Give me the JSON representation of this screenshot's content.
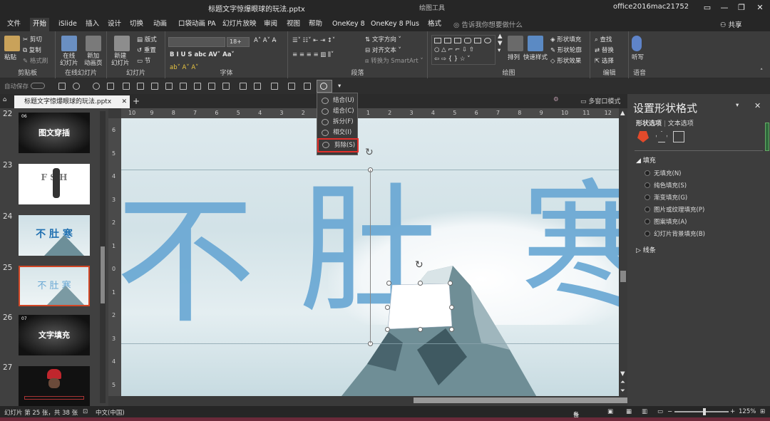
{
  "titlebar": {
    "filename": "标题文字惊爆眼球的玩法.pptx",
    "context": "绘图工具",
    "user": "office2016mac21752"
  },
  "tabs": [
    "文件",
    "开始",
    "iSlide",
    "插入",
    "设计",
    "切换",
    "动画",
    "口袋动画 PA",
    "幻灯片放映",
    "审阅",
    "视图",
    "帮助",
    "OneKey 8",
    "OneKey 8 Plus",
    "格式"
  ],
  "tellme": "告诉我你想要做什么",
  "share": "共享",
  "ribbon": {
    "clipboard": {
      "label": "剪贴板",
      "paste": "粘贴",
      "cut": "剪切",
      "copy": "复制",
      "painter": "格式刷"
    },
    "online": {
      "label": "在线幻灯片",
      "online_slide": "在线\n幻灯片",
      "new_anim": "新加\n动画页"
    },
    "slides": {
      "label": "幻灯片",
      "new": "新建\n幻灯片",
      "layout": "版式",
      "reset": "重置",
      "section": "节"
    },
    "font": {
      "label": "字体",
      "size": "18+"
    },
    "paragraph": {
      "label": "段落",
      "direction": "文字方向",
      "align": "对齐文本",
      "smartart": "转换为 SmartArt"
    },
    "drawing": {
      "label": "绘图",
      "arrange": "排列",
      "quick": "快速样式",
      "fill": "形状填充",
      "outline": "形状轮廓",
      "effect": "形状效果"
    },
    "editing": {
      "label": "编辑",
      "find": "查找",
      "replace": "替换",
      "select": "选择"
    },
    "voice": {
      "label": "语音",
      "dictate": "听写"
    }
  },
  "qat": {
    "autosave": "自动保存"
  },
  "doc_tab": "标题文字惊爆眼球的玩法.pptx",
  "multiwin": "多窗口模式",
  "thumbnails": [
    {
      "num": "22",
      "tag": "06",
      "label": "图文穿插"
    },
    {
      "num": "23",
      "label": "F S H"
    },
    {
      "num": "24",
      "label": "不 肚 寒"
    },
    {
      "num": "25",
      "label": "不 肚 寒"
    },
    {
      "num": "26",
      "tag": "07",
      "label": "文字填充"
    },
    {
      "num": "27",
      "label": ""
    }
  ],
  "hruler": [
    "10",
    "9",
    "8",
    "7",
    "6",
    "5",
    "4",
    "3",
    "2",
    "1",
    "0",
    "1",
    "2",
    "3",
    "4",
    "5",
    "6",
    "7",
    "8",
    "9",
    "10",
    "11",
    "12"
  ],
  "vruler": [
    "6",
    "5",
    "4",
    "3",
    "2",
    "1",
    "0",
    "1",
    "2",
    "3",
    "4",
    "5"
  ],
  "canvas": {
    "char1": "不",
    "char2": "肚",
    "char3": "寒"
  },
  "menu": {
    "combine": "结合(U)",
    "union": "组合(C)",
    "fragment": "拆分(F)",
    "intersect": "相交(I)",
    "subtract": "剪除(S)"
  },
  "pane": {
    "title": "设置形状格式",
    "tab_shape": "形状选项",
    "tab_text": "文本选项",
    "fill": "填充",
    "fill_options": [
      "无填充(N)",
      "纯色填充(S)",
      "渐变填充(G)",
      "图片或纹理填充(P)",
      "图案填充(A)",
      "幻灯片背景填充(B)"
    ],
    "line": "线条"
  },
  "status": {
    "slide": "幻灯片 第 25 张，共 38 张",
    "lang": "中文(中国)",
    "notes": "备注",
    "zoom": "125%"
  }
}
